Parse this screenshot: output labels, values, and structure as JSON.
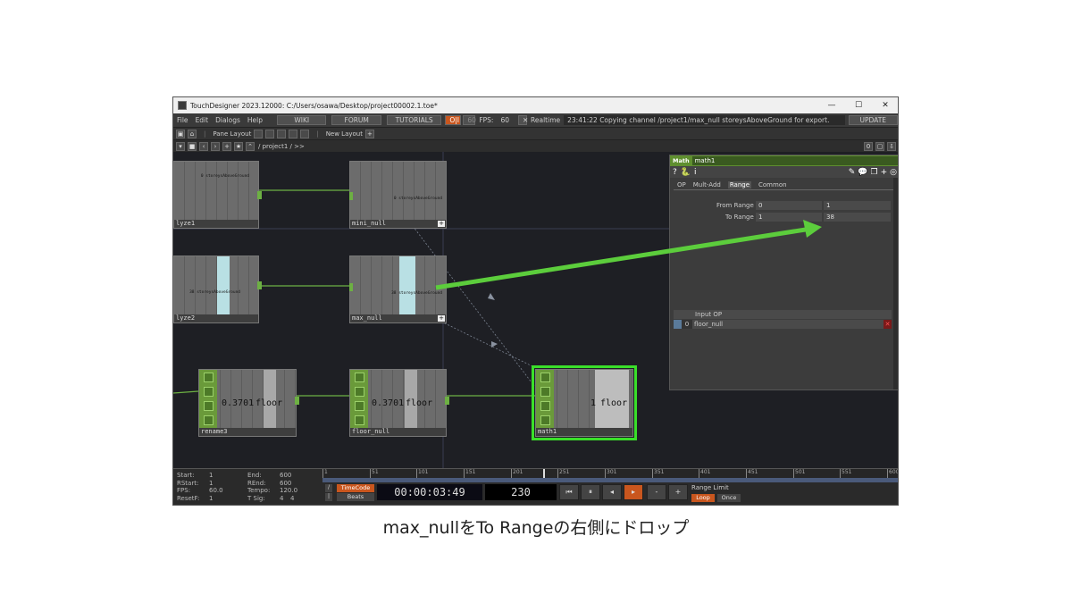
{
  "window": {
    "title": "TouchDesigner 2023.12000: C:/Users/osawa/Desktop/project00002.1.toe*",
    "min": "—",
    "max": "☐",
    "close": "✕"
  },
  "menu": {
    "items": [
      "File",
      "Edit",
      "Dialogs",
      "Help"
    ],
    "wiki": "WIKI",
    "forum": "FORUM",
    "tutorials": "TUTORIALS",
    "oi": "O|I",
    "sixty": "60",
    "fps_label": "FPS:",
    "fps_value": "60",
    "realtime": "Realtime",
    "status": "23:41:22 Copying channel /project1/max_null storeysAboveGround for export.",
    "update": "UPDATE"
  },
  "toolbar": {
    "pane_layout": "Pane Layout",
    "new_layout": "New Layout"
  },
  "path": {
    "text": "/ project1 / >>",
    "zero": "0"
  },
  "nodes": {
    "analyze1": {
      "label": "lyze1",
      "mini": "0 storeysAboveGround"
    },
    "mini_null": {
      "label": "mini_null",
      "mini": "0 storeysAboveGround"
    },
    "analyze2": {
      "label": "lyze2",
      "mini": "38 storeysAboveGround"
    },
    "max_null": {
      "label": "max_null",
      "mini": "38 storeysAboveGround"
    },
    "rename3": {
      "label": "rename3",
      "value": "0.3701",
      "name": "floor"
    },
    "floor_null": {
      "label": "floor_null",
      "value": "0.3701",
      "name": "floor"
    },
    "math1": {
      "label": "math1",
      "value": "1",
      "name": "floor"
    }
  },
  "panel": {
    "type": "Math",
    "name": "math1",
    "tabs": [
      "OP",
      "Mult-Add",
      "Range",
      "Common"
    ],
    "from_label": "From Range",
    "from_a": "0",
    "from_b": "1",
    "to_label": "To Range",
    "to_a": "1",
    "to_b": "38",
    "input_header": "Input OP",
    "input_index": "0",
    "input_value": "floor_null"
  },
  "timeline": {
    "start_l": "Start:",
    "start": "1",
    "rstart_l": "RStart:",
    "rstart": "1",
    "fps_l": "FPS:",
    "fps": "60.0",
    "resetf_l": "ResetF:",
    "resetf": "1",
    "end_l": "End:",
    "end": "600",
    "rend_l": "REnd:",
    "rend": "600",
    "tempo_l": "Tempo:",
    "tempo": "120.0",
    "tsig_l": "T Sig:",
    "tsig_a": "4",
    "tsig_b": "4",
    "ticks": [
      "1",
      "51",
      "101",
      "151",
      "201",
      "251",
      "301",
      "351",
      "401",
      "451",
      "501",
      "551",
      "600"
    ],
    "timecode_btn": "TimeCode",
    "beats_btn": "Beats",
    "timecode": "00:00:03:49",
    "frame": "230",
    "range_limit": "Range Limit",
    "loop": "Loop",
    "once": "Once"
  },
  "caption": "max_nullをTo Rangeの右側にドロップ",
  "colors": {
    "accent_green": "#5ccd3c",
    "node_param_green": "#6a9a3a",
    "selected": "#3adf2a"
  }
}
